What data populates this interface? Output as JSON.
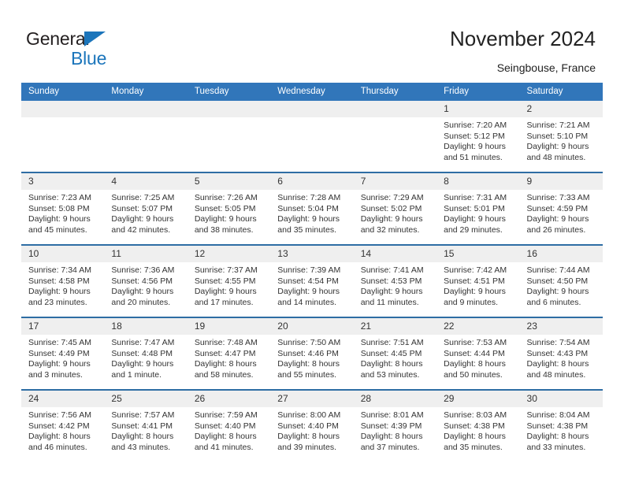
{
  "brand": {
    "word_one": "General",
    "word_two": "Blue",
    "triangle_color": "#1B75BB",
    "text_color": "#231f20"
  },
  "header": {
    "title": "November 2024",
    "subtitle": "Seingbouse, France"
  },
  "theme": {
    "header_blue": "#3176BA",
    "row_divider_blue": "#2E6DA4",
    "daynum_bg": "#EFEFEF",
    "text": "#333333"
  },
  "columns": [
    "Sunday",
    "Monday",
    "Tuesday",
    "Wednesday",
    "Thursday",
    "Friday",
    "Saturday"
  ],
  "weeks": [
    [
      {
        "day": "",
        "lines": []
      },
      {
        "day": "",
        "lines": []
      },
      {
        "day": "",
        "lines": []
      },
      {
        "day": "",
        "lines": []
      },
      {
        "day": "",
        "lines": []
      },
      {
        "day": "1",
        "lines": [
          "Sunrise: 7:20 AM",
          "Sunset: 5:12 PM",
          "Daylight: 9 hours",
          "and 51 minutes."
        ]
      },
      {
        "day": "2",
        "lines": [
          "Sunrise: 7:21 AM",
          "Sunset: 5:10 PM",
          "Daylight: 9 hours",
          "and 48 minutes."
        ]
      }
    ],
    [
      {
        "day": "3",
        "lines": [
          "Sunrise: 7:23 AM",
          "Sunset: 5:08 PM",
          "Daylight: 9 hours",
          "and 45 minutes."
        ]
      },
      {
        "day": "4",
        "lines": [
          "Sunrise: 7:25 AM",
          "Sunset: 5:07 PM",
          "Daylight: 9 hours",
          "and 42 minutes."
        ]
      },
      {
        "day": "5",
        "lines": [
          "Sunrise: 7:26 AM",
          "Sunset: 5:05 PM",
          "Daylight: 9 hours",
          "and 38 minutes."
        ]
      },
      {
        "day": "6",
        "lines": [
          "Sunrise: 7:28 AM",
          "Sunset: 5:04 PM",
          "Daylight: 9 hours",
          "and 35 minutes."
        ]
      },
      {
        "day": "7",
        "lines": [
          "Sunrise: 7:29 AM",
          "Sunset: 5:02 PM",
          "Daylight: 9 hours",
          "and 32 minutes."
        ]
      },
      {
        "day": "8",
        "lines": [
          "Sunrise: 7:31 AM",
          "Sunset: 5:01 PM",
          "Daylight: 9 hours",
          "and 29 minutes."
        ]
      },
      {
        "day": "9",
        "lines": [
          "Sunrise: 7:33 AM",
          "Sunset: 4:59 PM",
          "Daylight: 9 hours",
          "and 26 minutes."
        ]
      }
    ],
    [
      {
        "day": "10",
        "lines": [
          "Sunrise: 7:34 AM",
          "Sunset: 4:58 PM",
          "Daylight: 9 hours",
          "and 23 minutes."
        ]
      },
      {
        "day": "11",
        "lines": [
          "Sunrise: 7:36 AM",
          "Sunset: 4:56 PM",
          "Daylight: 9 hours",
          "and 20 minutes."
        ]
      },
      {
        "day": "12",
        "lines": [
          "Sunrise: 7:37 AM",
          "Sunset: 4:55 PM",
          "Daylight: 9 hours",
          "and 17 minutes."
        ]
      },
      {
        "day": "13",
        "lines": [
          "Sunrise: 7:39 AM",
          "Sunset: 4:54 PM",
          "Daylight: 9 hours",
          "and 14 minutes."
        ]
      },
      {
        "day": "14",
        "lines": [
          "Sunrise: 7:41 AM",
          "Sunset: 4:53 PM",
          "Daylight: 9 hours",
          "and 11 minutes."
        ]
      },
      {
        "day": "15",
        "lines": [
          "Sunrise: 7:42 AM",
          "Sunset: 4:51 PM",
          "Daylight: 9 hours",
          "and 9 minutes."
        ]
      },
      {
        "day": "16",
        "lines": [
          "Sunrise: 7:44 AM",
          "Sunset: 4:50 PM",
          "Daylight: 9 hours",
          "and 6 minutes."
        ]
      }
    ],
    [
      {
        "day": "17",
        "lines": [
          "Sunrise: 7:45 AM",
          "Sunset: 4:49 PM",
          "Daylight: 9 hours",
          "and 3 minutes."
        ]
      },
      {
        "day": "18",
        "lines": [
          "Sunrise: 7:47 AM",
          "Sunset: 4:48 PM",
          "Daylight: 9 hours",
          "and 1 minute."
        ]
      },
      {
        "day": "19",
        "lines": [
          "Sunrise: 7:48 AM",
          "Sunset: 4:47 PM",
          "Daylight: 8 hours",
          "and 58 minutes."
        ]
      },
      {
        "day": "20",
        "lines": [
          "Sunrise: 7:50 AM",
          "Sunset: 4:46 PM",
          "Daylight: 8 hours",
          "and 55 minutes."
        ]
      },
      {
        "day": "21",
        "lines": [
          "Sunrise: 7:51 AM",
          "Sunset: 4:45 PM",
          "Daylight: 8 hours",
          "and 53 minutes."
        ]
      },
      {
        "day": "22",
        "lines": [
          "Sunrise: 7:53 AM",
          "Sunset: 4:44 PM",
          "Daylight: 8 hours",
          "and 50 minutes."
        ]
      },
      {
        "day": "23",
        "lines": [
          "Sunrise: 7:54 AM",
          "Sunset: 4:43 PM",
          "Daylight: 8 hours",
          "and 48 minutes."
        ]
      }
    ],
    [
      {
        "day": "24",
        "lines": [
          "Sunrise: 7:56 AM",
          "Sunset: 4:42 PM",
          "Daylight: 8 hours",
          "and 46 minutes."
        ]
      },
      {
        "day": "25",
        "lines": [
          "Sunrise: 7:57 AM",
          "Sunset: 4:41 PM",
          "Daylight: 8 hours",
          "and 43 minutes."
        ]
      },
      {
        "day": "26",
        "lines": [
          "Sunrise: 7:59 AM",
          "Sunset: 4:40 PM",
          "Daylight: 8 hours",
          "and 41 minutes."
        ]
      },
      {
        "day": "27",
        "lines": [
          "Sunrise: 8:00 AM",
          "Sunset: 4:40 PM",
          "Daylight: 8 hours",
          "and 39 minutes."
        ]
      },
      {
        "day": "28",
        "lines": [
          "Sunrise: 8:01 AM",
          "Sunset: 4:39 PM",
          "Daylight: 8 hours",
          "and 37 minutes."
        ]
      },
      {
        "day": "29",
        "lines": [
          "Sunrise: 8:03 AM",
          "Sunset: 4:38 PM",
          "Daylight: 8 hours",
          "and 35 minutes."
        ]
      },
      {
        "day": "30",
        "lines": [
          "Sunrise: 8:04 AM",
          "Sunset: 4:38 PM",
          "Daylight: 8 hours",
          "and 33 minutes."
        ]
      }
    ]
  ]
}
